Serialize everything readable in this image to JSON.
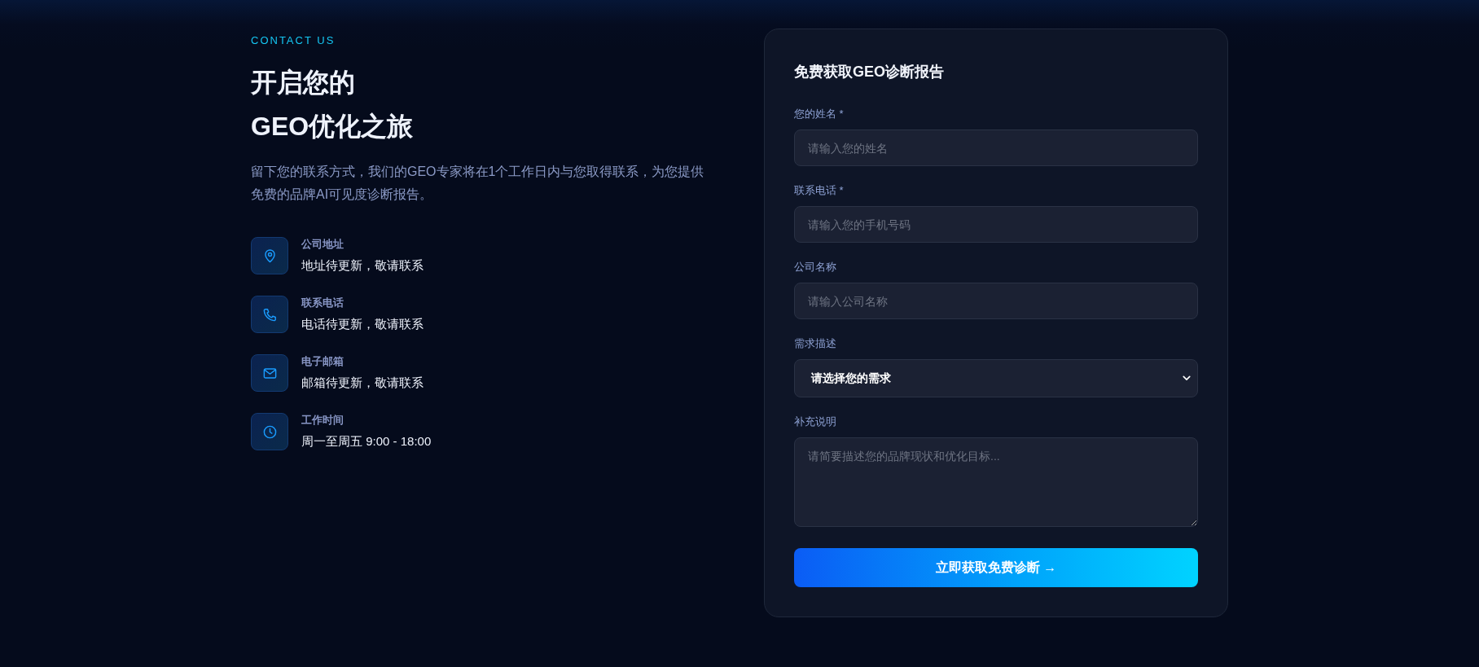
{
  "intro": {
    "eyebrow": "CONTACT US",
    "heading_lines": [
      "开启您的",
      "GEO优化之旅"
    ],
    "description": "留下您的联系方式，我们的GEO专家将在1个工作日内与您取得联系，为您提供免费的品牌AI可见度诊断报告。"
  },
  "contact_items": [
    {
      "kind": "address",
      "label": "公司地址",
      "value": "地址待更新，敬请联系"
    },
    {
      "kind": "phone",
      "label": "联系电话",
      "value": "电话待更新，敬请联系"
    },
    {
      "kind": "email",
      "label": "电子邮箱",
      "value": "邮箱待更新，敬请联系"
    },
    {
      "kind": "hours",
      "label": "工作时间",
      "value": "周一至周五 9:00 - 18:00"
    }
  ],
  "form": {
    "title": "免费获取GEO诊断报告",
    "fields": [
      {
        "kind": "input",
        "label": "您的姓名 *",
        "placeholder": "请输入您的姓名"
      },
      {
        "kind": "input",
        "label": "联系电话 *",
        "placeholder": "请输入您的手机号码"
      },
      {
        "kind": "input",
        "label": "公司名称",
        "placeholder": "请输入公司名称"
      },
      {
        "kind": "select",
        "label": "需求描述",
        "value": "请选择您的需求"
      },
      {
        "kind": "textarea",
        "label": "补充说明",
        "placeholder": "请简要描述您的品牌现状和优化目标..."
      }
    ],
    "submit": "立即获取免费诊断 →"
  }
}
